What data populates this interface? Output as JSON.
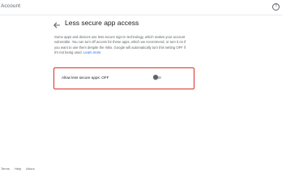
{
  "header": {
    "app_title": "Account",
    "help_icon": "help-circle-icon",
    "help_glyph": "?"
  },
  "page": {
    "back_icon": "arrow-back-icon",
    "title": "Less secure app access",
    "description_text": "Some apps and devices use less secure sign-in technology, which makes your account vulnerable. You can turn off access for these apps, which we recommend, or turn it on if you want to use them despite the risks. Google will automatically turn this setting OFF if it's not being used.",
    "learn_more_label": "Learn more"
  },
  "setting": {
    "label": "Allow less secure apps: OFF",
    "toggle_state": "off"
  },
  "footer": {
    "links": [
      "Terms",
      "Help",
      "About"
    ]
  },
  "colors": {
    "highlight_border": "#d93025",
    "link": "#1a73e8",
    "toggle_knob": "#5f6368",
    "toggle_track": "#bdc1c6"
  }
}
